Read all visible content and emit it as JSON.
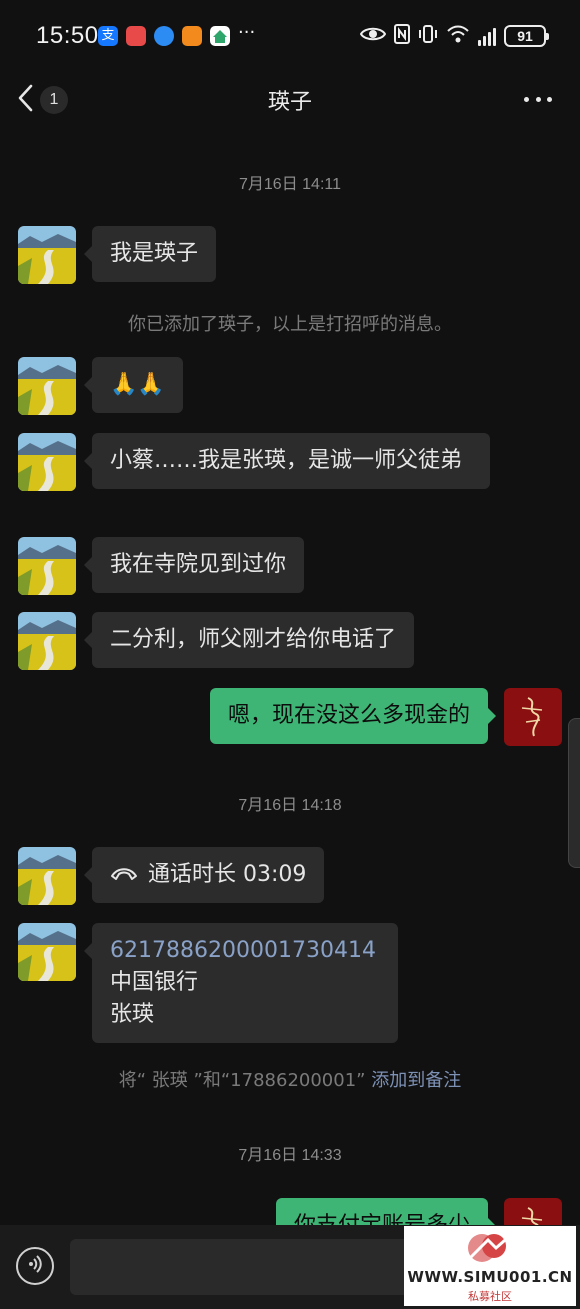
{
  "status_bar": {
    "time": "15:50",
    "battery": "91",
    "more_indicator": "···",
    "app_icons": [
      {
        "name": "alipay-icon",
        "color": "#1677ff",
        "glyph": "支"
      },
      {
        "name": "red-app-icon",
        "color": "#e84a4a",
        "glyph": "▣"
      },
      {
        "name": "message-app-icon",
        "color": "#2c8cf4",
        "glyph": "●"
      },
      {
        "name": "orange-app-icon",
        "color": "#f28a1e",
        "glyph": "▶"
      },
      {
        "name": "green-home-app-icon",
        "color": "#2ea56a",
        "glyph": "⌂"
      }
    ]
  },
  "nav": {
    "title": "瑛子",
    "unread_count": "1"
  },
  "messages": {
    "ts1": "7月16日 14:11",
    "m1": "我是瑛子",
    "note_added": "你已添加了瑛子，以上是打招呼的消息。",
    "m2": "🙏🙏",
    "m3": "小蔡……我是张瑛，是诚一师父徒弟",
    "m4": "我在寺院见到过你",
    "m5": "二分利，师父刚才给你电话了",
    "m6_sent": "嗯，现在没这么多现金的",
    "ts2": "7月16日 14:18",
    "call_label": "通话时长 03:09",
    "card_number": "6217886200001730414",
    "card_bank": "中国银行",
    "card_name": "张瑛",
    "note_remark_prefix": "将“ 张瑛 ”和“17886200001” ",
    "note_remark_link": "添加到备注",
    "ts3": "7月16日 14:33",
    "m7_sent_partial": "你支付宝账号多少"
  },
  "input": {
    "placeholder": ""
  },
  "watermark": {
    "text": "WWW.SIMU001.CN",
    "sub": "私募社区"
  },
  "colors": {
    "sent_bubble": "#3eb575",
    "recv_bubble": "#2c2c2c",
    "background": "#111111",
    "link": "#7d91b5"
  }
}
